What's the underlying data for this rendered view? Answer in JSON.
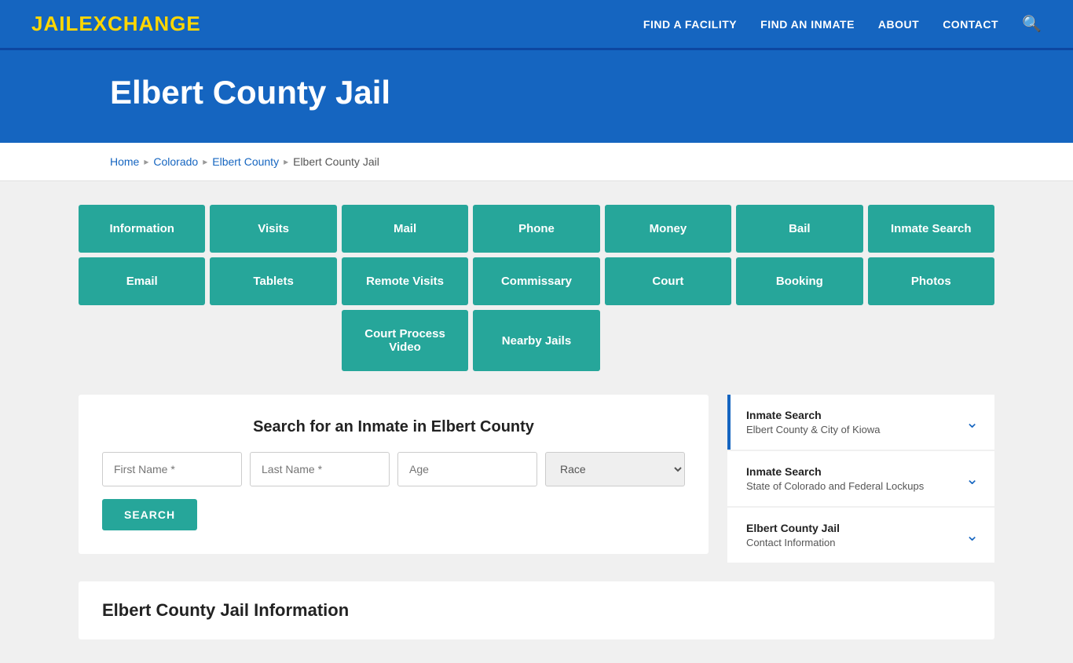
{
  "nav": {
    "logo_jail": "JAIL",
    "logo_exchange": "EXCHANGE",
    "links": [
      {
        "label": "FIND A FACILITY",
        "name": "find-facility-link"
      },
      {
        "label": "FIND AN INMATE",
        "name": "find-inmate-link"
      },
      {
        "label": "ABOUT",
        "name": "about-link"
      },
      {
        "label": "CONTACT",
        "name": "contact-link"
      }
    ]
  },
  "hero": {
    "title": "Elbert County Jail"
  },
  "breadcrumb": {
    "items": [
      {
        "label": "Home",
        "name": "breadcrumb-home"
      },
      {
        "label": "Colorado",
        "name": "breadcrumb-colorado"
      },
      {
        "label": "Elbert County",
        "name": "breadcrumb-elbert-county"
      },
      {
        "label": "Elbert County Jail",
        "name": "breadcrumb-elbert-county-jail"
      }
    ]
  },
  "grid_row1": [
    {
      "label": "Information",
      "name": "btn-information"
    },
    {
      "label": "Visits",
      "name": "btn-visits"
    },
    {
      "label": "Mail",
      "name": "btn-mail"
    },
    {
      "label": "Phone",
      "name": "btn-phone"
    },
    {
      "label": "Money",
      "name": "btn-money"
    },
    {
      "label": "Bail",
      "name": "btn-bail"
    },
    {
      "label": "Inmate Search",
      "name": "btn-inmate-search"
    }
  ],
  "grid_row2": [
    {
      "label": "Email",
      "name": "btn-email"
    },
    {
      "label": "Tablets",
      "name": "btn-tablets"
    },
    {
      "label": "Remote Visits",
      "name": "btn-remote-visits"
    },
    {
      "label": "Commissary",
      "name": "btn-commissary"
    },
    {
      "label": "Court",
      "name": "btn-court"
    },
    {
      "label": "Booking",
      "name": "btn-booking"
    },
    {
      "label": "Photos",
      "name": "btn-photos"
    }
  ],
  "grid_row3": [
    {
      "label": "",
      "empty": true
    },
    {
      "label": "",
      "empty": true
    },
    {
      "label": "Court Process Video",
      "name": "btn-court-process-video"
    },
    {
      "label": "Nearby Jails",
      "name": "btn-nearby-jails"
    },
    {
      "label": "",
      "empty": true
    },
    {
      "label": "",
      "empty": true
    },
    {
      "label": "",
      "empty": true
    }
  ],
  "search": {
    "title": "Search for an Inmate in Elbert County",
    "first_name_placeholder": "First Name *",
    "last_name_placeholder": "Last Name *",
    "age_placeholder": "Age",
    "race_placeholder": "Race",
    "button_label": "SEARCH"
  },
  "sidebar": {
    "items": [
      {
        "title": "Inmate Search",
        "subtitle": "Elbert County & City of Kiowa",
        "name": "sidebar-inmate-search-county"
      },
      {
        "title": "Inmate Search",
        "subtitle": "State of Colorado and Federal Lockups",
        "name": "sidebar-inmate-search-state"
      },
      {
        "title": "Elbert County Jail",
        "subtitle": "Contact Information",
        "name": "sidebar-contact-info"
      }
    ]
  },
  "bottom": {
    "title": "Elbert County Jail Information"
  }
}
